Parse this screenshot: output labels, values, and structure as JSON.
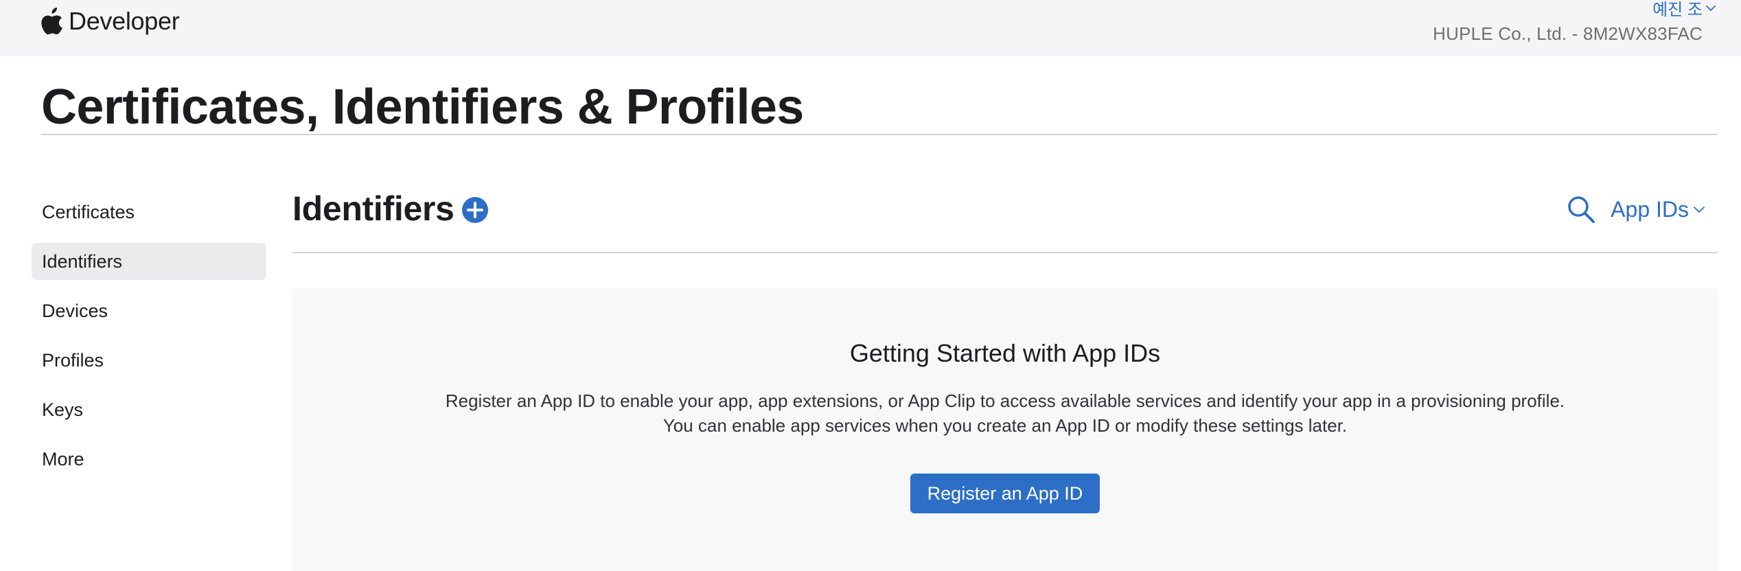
{
  "header": {
    "brand_label": "Developer",
    "user_name": "예진 조",
    "team_label": "HUPLE Co., Ltd. - 8M2WX83FAC"
  },
  "page": {
    "title": "Certificates, Identifiers & Profiles"
  },
  "sidebar": {
    "items": [
      {
        "label": "Certificates",
        "active": false
      },
      {
        "label": "Identifiers",
        "active": true
      },
      {
        "label": "Devices",
        "active": false
      },
      {
        "label": "Profiles",
        "active": false
      },
      {
        "label": "Keys",
        "active": false
      },
      {
        "label": "More",
        "active": false
      }
    ]
  },
  "section": {
    "title": "Identifiers",
    "filter_label": "App IDs"
  },
  "empty_state": {
    "title": "Getting Started with App IDs",
    "line1": "Register an App ID to enable your app, app extensions, or App Clip to access available services and identify your app in a provisioning profile.",
    "line2": "You can enable app services when you create an App ID or modify these settings later.",
    "button_label": "Register an App ID"
  },
  "icons": {
    "brand": "apple-logo-icon",
    "add": "plus-circle-icon",
    "search": "search-icon",
    "dropdown": "chevron-down-icon"
  },
  "colors": {
    "accent": "#2d6fc6",
    "topbar_bg": "#f5f5f7",
    "active_item_bg": "#ebebed",
    "panel_bg": "#f8f8f8",
    "text": "#1d1d1f",
    "muted_text": "#6e6e73"
  }
}
